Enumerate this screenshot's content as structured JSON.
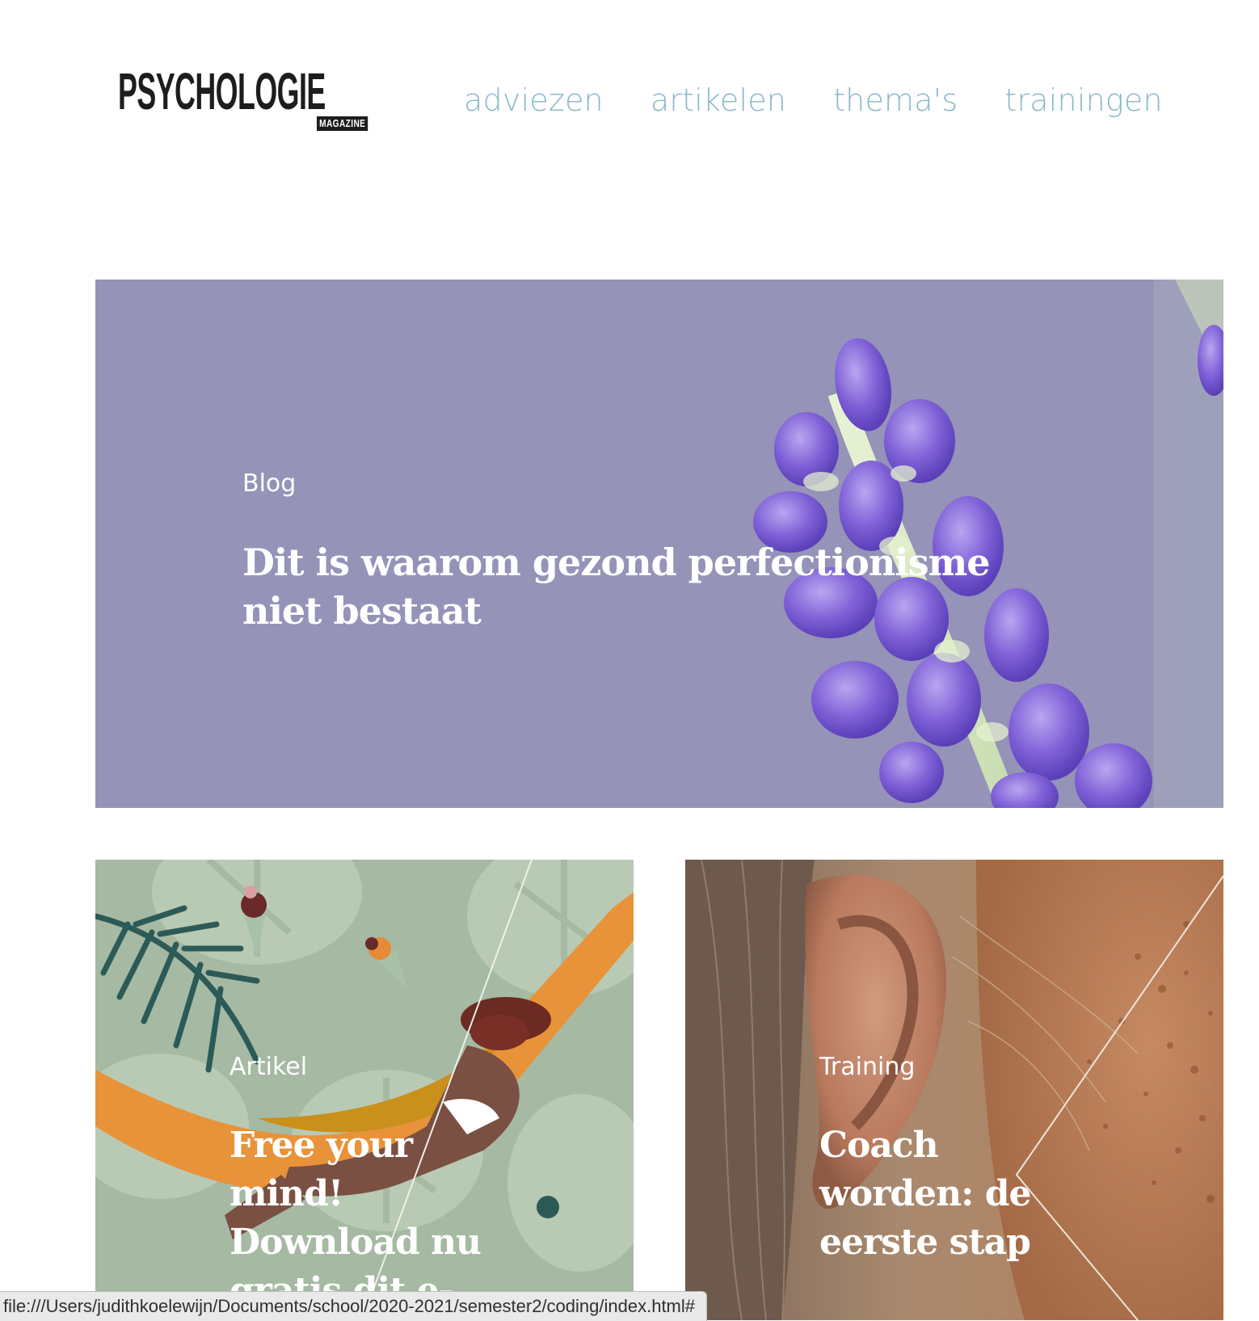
{
  "header": {
    "logo_main": "PSYCHOLOGIE",
    "logo_sub": "MAGAZINE",
    "nav": [
      "adviezen",
      "artikelen",
      "thema's",
      "trainingen"
    ]
  },
  "hero": {
    "category": "Blog",
    "title": "Dit is waarom gezond perfectionisme niet bestaat",
    "image": "lavender-flower"
  },
  "cards": [
    {
      "category": "Artikel",
      "title": "Free your mind! Download nu gratis dit e-book",
      "image": "hammock-illustration"
    },
    {
      "category": "Training",
      "title": "Coach worden: de eerste stap",
      "image": "freckled-ear-photo"
    }
  ],
  "statusbar": {
    "url": "file:///Users/judithkoelewijn/Documents/school/2020-2021/semester2/coding/index.html#"
  },
  "colors": {
    "nav": "#8ab9c9",
    "hero_bg": "#9391b7",
    "card_left_bg": "#a9bba5"
  }
}
